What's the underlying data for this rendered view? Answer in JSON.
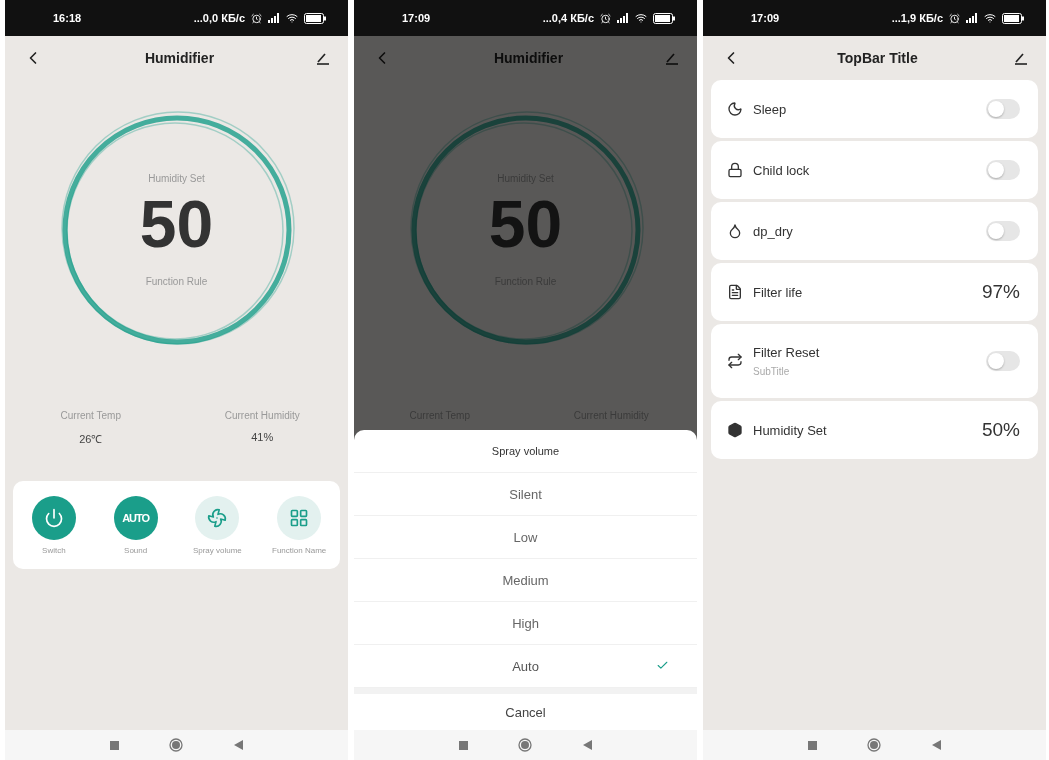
{
  "screens": [
    {
      "kind": "dial",
      "status_bar": {
        "time": "16:18",
        "speed": "...0,0 КБ/с"
      },
      "title": "Humidifier",
      "dial": {
        "label": "Humidity Set",
        "value": "50",
        "caption": "Function Rule"
      },
      "stats": [
        {
          "label": "Current Temp",
          "value": "26℃"
        },
        {
          "label": "Current Humidity",
          "value": "41%"
        }
      ],
      "controls": [
        {
          "label": "Switch",
          "active": true
        },
        {
          "label": "Sound",
          "badge": "AUTO",
          "active": true
        },
        {
          "label": "Spray volume",
          "active": false
        },
        {
          "label": "Function Name",
          "active": false
        }
      ]
    },
    {
      "kind": "sheet",
      "status_bar": {
        "time": "17:09",
        "speed": "...0,4 КБ/с"
      },
      "title": "Humidifier",
      "dial": {
        "label": "Humidity Set",
        "value": "50",
        "caption": "Function Rule"
      },
      "stats": [
        {
          "label": "Current Temp"
        },
        {
          "label": "Current Humidity"
        }
      ],
      "sheet": {
        "title": "Spray volume",
        "options": [
          {
            "label": "Silent",
            "selected": false
          },
          {
            "label": "Low",
            "selected": false
          },
          {
            "label": "Medium",
            "selected": false
          },
          {
            "label": "High",
            "selected": false
          },
          {
            "label": "Auto",
            "selected": true
          }
        ],
        "cancel": "Cancel"
      }
    },
    {
      "kind": "list",
      "status_bar": {
        "time": "17:09",
        "speed": "...1,9 КБ/с"
      },
      "title": "TopBar Title",
      "rows": [
        {
          "kind": "toggle",
          "label": "Sleep",
          "on": false
        },
        {
          "kind": "toggle",
          "label": "Child lock",
          "on": false
        },
        {
          "kind": "toggle",
          "label": "dp_dry",
          "on": false
        },
        {
          "kind": "value",
          "label": "Filter life",
          "value": "97%"
        },
        {
          "kind": "toggle",
          "label": "Filter Reset",
          "subtitle": "SubTitle",
          "on": false
        },
        {
          "kind": "value",
          "label": "Humidity Set",
          "value": "50%"
        }
      ]
    }
  ]
}
